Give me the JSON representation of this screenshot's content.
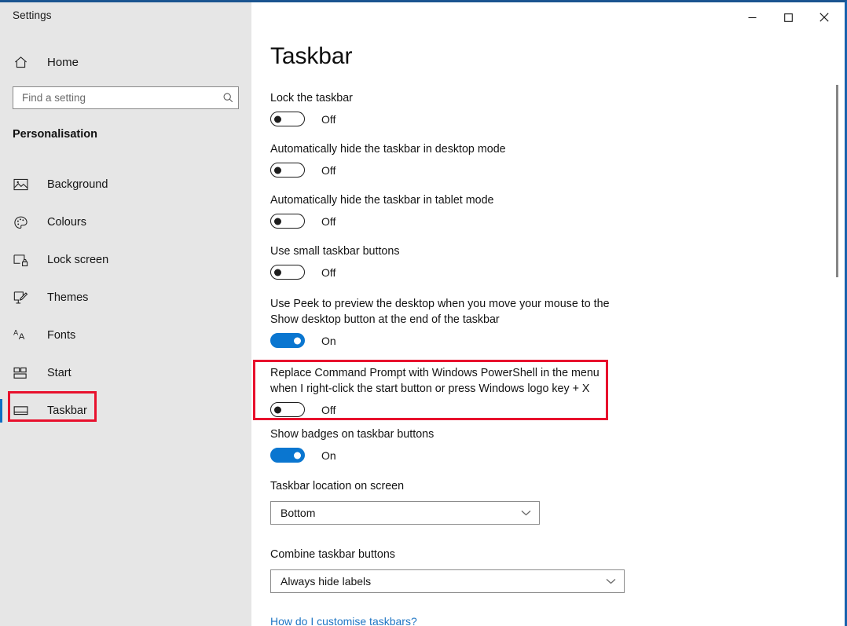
{
  "window": {
    "app_title": "Settings",
    "accent_blue": "#0a76d0",
    "highlight_red": "#e8112d",
    "frame_blue": "#1a5490",
    "controls": [
      {
        "name": "minimize",
        "glyph": "—"
      },
      {
        "name": "maximize",
        "glyph": "□"
      },
      {
        "name": "close",
        "glyph": "✕"
      }
    ]
  },
  "sidebar": {
    "home_label": "Home",
    "search": {
      "placeholder": "Find a setting",
      "value": "",
      "icon": "search-icon"
    },
    "category_title": "Personalisation",
    "items": [
      {
        "label": "Background",
        "icon": "image-icon",
        "selected": false
      },
      {
        "label": "Colours",
        "icon": "palette-icon",
        "selected": false
      },
      {
        "label": "Lock screen",
        "icon": "lock-screen-icon",
        "selected": false
      },
      {
        "label": "Themes",
        "icon": "brush-icon",
        "selected": false
      },
      {
        "label": "Fonts",
        "icon": "font-aa-icon",
        "selected": false
      },
      {
        "label": "Start",
        "icon": "start-grid-icon",
        "selected": false
      },
      {
        "label": "Taskbar",
        "icon": "taskbar-icon",
        "selected": true
      }
    ]
  },
  "main": {
    "page_title": "Taskbar",
    "settings": [
      {
        "id": "lock-the-taskbar",
        "label": "Lock the taskbar",
        "state": "Off",
        "on": false
      },
      {
        "id": "auto-hide-desktop",
        "label": "Automatically hide the taskbar in desktop mode",
        "state": "Off",
        "on": false
      },
      {
        "id": "auto-hide-tablet",
        "label": "Automatically hide the taskbar in tablet mode",
        "state": "Off",
        "on": false
      },
      {
        "id": "small-taskbar-buttons",
        "label": "Use small taskbar buttons",
        "state": "Off",
        "on": false
      },
      {
        "id": "use-peek",
        "label": "Use Peek to preview the desktop when you move your mouse to the Show desktop button at the end of the taskbar",
        "state": "On",
        "on": true
      },
      {
        "id": "replace-command-prompt",
        "label": "Replace Command Prompt with Windows PowerShell in the menu when I right-click the start button or press Windows logo key + X",
        "state": "Off",
        "on": false,
        "highlighted": true
      },
      {
        "id": "show-badges",
        "label": "Show badges on taskbar buttons",
        "state": "On",
        "on": true
      }
    ],
    "dropdowns": [
      {
        "id": "taskbar-location",
        "label": "Taskbar location on screen",
        "value": "Bottom"
      },
      {
        "id": "combine-taskbar-buttons",
        "label": "Combine taskbar buttons",
        "value": "Always hide labels"
      }
    ],
    "help_link": "How do I customise taskbars?"
  }
}
